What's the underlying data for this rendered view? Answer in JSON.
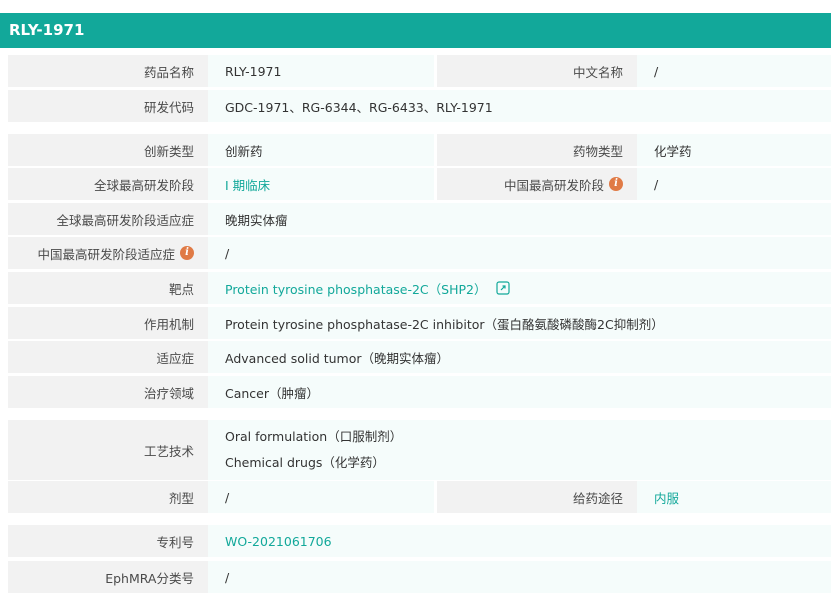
{
  "header": {
    "title": "RLY-1971"
  },
  "rows": {
    "drug_name": {
      "label": "药品名称",
      "value": "RLY-1971"
    },
    "chinese_name": {
      "label": "中文名称",
      "value": "/"
    },
    "rd_code": {
      "label": "研发代码",
      "value": "GDC-1971、RG-6344、RG-6433、RLY-1971"
    },
    "innovation_type": {
      "label": "创新类型",
      "value": "创新药"
    },
    "drug_type": {
      "label": "药物类型",
      "value": "化学药"
    },
    "global_stage": {
      "label": "全球最高研发阶段",
      "value": "I 期临床"
    },
    "china_stage": {
      "label": "中国最高研发阶段",
      "value": "/"
    },
    "global_indication": {
      "label": "全球最高研发阶段适应症",
      "value": "晚期实体瘤"
    },
    "china_indication": {
      "label": "中国最高研发阶段适应症",
      "value": "/"
    },
    "target": {
      "label": "靶点",
      "value": "Protein tyrosine phosphatase-2C（SHP2）"
    },
    "mechanism": {
      "label": "作用机制",
      "value": "Protein tyrosine phosphatase-2C inhibitor（蛋白酪氨酸磷酸酶2C抑制剂）"
    },
    "indication": {
      "label": "适应症",
      "value": "Advanced solid tumor（晚期实体瘤）"
    },
    "therapeutic_area": {
      "label": "治疗领域",
      "value": "Cancer（肿瘤）"
    },
    "technology": {
      "label": "工艺技术",
      "values": [
        "Oral formulation（口服制剂）",
        "Chemical drugs（化学药）"
      ]
    },
    "dosage_form": {
      "label": "剂型",
      "value": "/"
    },
    "route": {
      "label": "给药途径",
      "value": "内服"
    },
    "patent": {
      "label": "专利号",
      "value": "WO-2021061706"
    },
    "ephmra": {
      "label": "EphMRA分类号",
      "value": "/"
    }
  },
  "icons": {
    "info": "info-icon",
    "external_link": "external-link-icon"
  },
  "colors": {
    "accent": "#12a89a",
    "info_badge": "#e07a45",
    "label_bg": "#f2f2f2",
    "value_bg": "#f5fcfb"
  }
}
